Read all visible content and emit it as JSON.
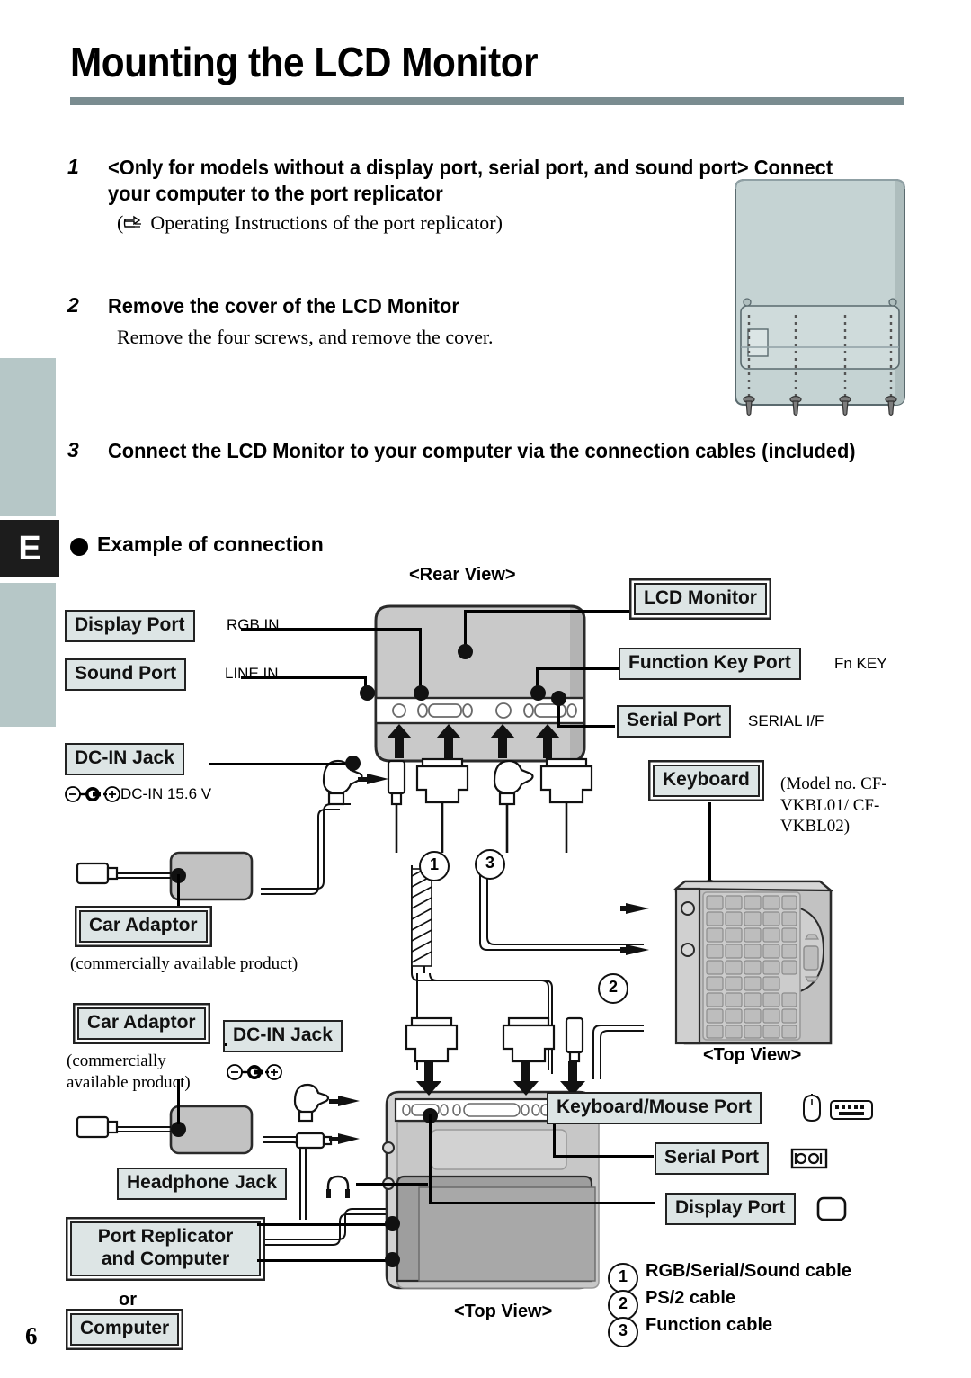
{
  "page": {
    "title": "Mounting the LCD Monitor",
    "number": "6",
    "edge_tab_letter": "E"
  },
  "steps": [
    {
      "num": "1",
      "heading": "<Only for models without a display port, serial port, and sound port> Connect your computer to the port replicator",
      "sub": "Operating Instructions of the port replicator)",
      "sub_prefix": "("
    },
    {
      "num": "2",
      "heading": "Remove the cover of the LCD Monitor",
      "sub": "Remove the four screws, and remove the cover."
    },
    {
      "num": "3",
      "heading": "Connect the LCD Monitor to your computer via the connection cables (included)"
    }
  ],
  "example": {
    "heading": "Example of connection"
  },
  "diagram": {
    "view_rear": "<Rear View>",
    "view_top_keyboard": "<Top View>",
    "view_top_computer": "<Top View>",
    "labels": {
      "display_port_left": "Display Port",
      "sound_port": "Sound Port",
      "dc_in_jack_top": "DC-IN Jack",
      "lcd_monitor": "LCD Monitor",
      "function_key_port": "Function Key Port",
      "serial_port_top": "Serial Port",
      "keyboard": "Keyboard",
      "car_adaptor_1": "Car Adaptor",
      "car_adaptor_2": "Car Adaptor",
      "dc_in_jack_bottom": "DC-IN Jack",
      "headphone_jack": "Headphone Jack",
      "port_replicator_and_computer": "Port Replicator and Computer",
      "or": "or",
      "computer": "Computer",
      "keyboard_mouse_port": "Keyboard/Mouse Port",
      "serial_port_bottom": "Serial Port",
      "display_port_bottom": "Display Port"
    },
    "annotations": {
      "rgb_in": "RGB IN",
      "line_in": "LINE IN",
      "dc_in_rating": "DC-IN 15.6 V",
      "fn_key": "Fn KEY",
      "serial_if": "SERIAL I/F",
      "keyboard_model": "(Model no. CF-VKBL01/ CF-VKBL02)",
      "commercially_1": "(commercially available product)",
      "commercially_2": "(commercially available product)"
    },
    "cable_markers": [
      "1",
      "2",
      "3"
    ],
    "legend": [
      {
        "num": "1",
        "text": "RGB/Serial/Sound cable"
      },
      {
        "num": "2",
        "text": "PS/2 cable"
      },
      {
        "num": "3",
        "text": "Function cable"
      }
    ]
  },
  "colors": {
    "rule": "#7a8c90",
    "tab": "#b6c7c7",
    "tab_active": "#1c1c1c",
    "label_fill": "#dde5e5",
    "device_gray": "#bdbdbd",
    "monitor_body": "#c5d3d3"
  }
}
